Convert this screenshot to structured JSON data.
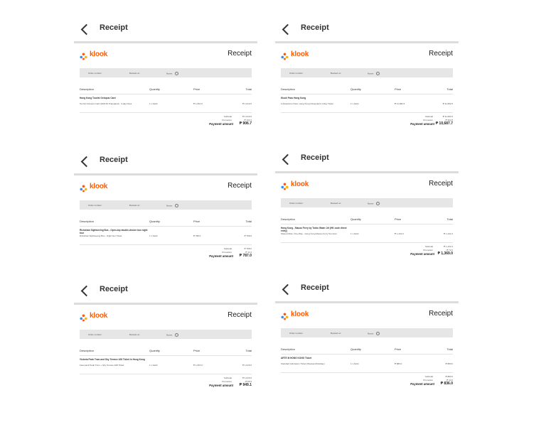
{
  "nav": {
    "title": "Receipt"
  },
  "brand": {
    "name": "klook"
  },
  "labels": {
    "receipt": "Receipt",
    "order_number": "Order number:",
    "booked_on": "Booked on:",
    "name": "Name:",
    "description": "Description",
    "quantity": "Quantity",
    "price": "Price",
    "total": "Total",
    "subtotal": "Subtotal",
    "promotion": "Promotion",
    "payment_amount": "Payment amount"
  },
  "colors": {
    "brand": "#ff5b00",
    "infobar": "#e6e6e6",
    "divider": "#dcdcdc"
  },
  "receipts": [
    {
      "order_number": "",
      "booked_on": "",
      "name": "",
      "item_title": "Hong Kong Tourist Octopus Card",
      "item_desc": "Tourist Octopus Card (HK$ 50 Preloaded) - 3-day Pass",
      "quantity": "1 x Adult",
      "price": "₱ 1,010.0",
      "total": "₱ 1,010.0",
      "subtotal": "₱ 1,010.0",
      "promotion": "- ₱ 103.3",
      "payment": "₱ 906.7"
    },
    {
      "order_number": "",
      "booked_on": "",
      "name": "",
      "item_title": "Klook Pass Hong Kong",
      "item_desc": "2 Attractions Pass: Hong Kong Disneyland 1-Day Ticket",
      "quantity": "1 x Adult",
      "price": "₱ 11,082.5",
      "total": "₱ 11,082.5",
      "subtotal": "₱ 11,082.5",
      "promotion": "- ₱ 394.8",
      "payment": "₱ 10,687.7"
    },
    {
      "order_number": "",
      "booked_on": "",
      "name": "",
      "item_title": "Rickshaw Sightseeing Bus - Open-top double-decker bus night tour",
      "item_desc": "Rickshaw Sightseeing Bus - Night bus Ticket",
      "quantity": "1 x Adult",
      "price": "₱ 798.0",
      "total": "₱ 798.0",
      "subtotal": "₱ 798.0",
      "promotion": "- ₱ 11.0",
      "payment": "₱ 787.0"
    },
    {
      "order_number": "",
      "booked_on": "",
      "name": "",
      "item_title": "Hong Kong - Macau Ferry by Turbo Water Jet (HK code direct entry)",
      "item_desc": "Shared Ride: One-Way - Hong Kong Macau Ferry Terminal",
      "quantity": "1 x Adult",
      "price": "₱ 1,441.0",
      "total": "₱ 1,441.0",
      "subtotal": "₱ 1,441.0",
      "promotion": "- ₱ 72.0",
      "payment": "₱ 1,369.0"
    },
    {
      "order_number": "",
      "booked_on": "",
      "name": "",
      "item_title": "Victoria Peak Tram and Sky Terrace 428 Ticket in Hong Kong",
      "item_desc": "Fast-track Peak Tram + Sky Terrace 428 Ticket",
      "quantity": "1 x Adult",
      "price": "₱ 1,015.0",
      "total": "₱ 1,015.0",
      "subtotal": "₱ 1,015.0",
      "promotion": "- ₱ 65.9",
      "payment": "₱ 949.1"
    },
    {
      "order_number": "",
      "booked_on": "",
      "name": "",
      "item_title": "ARTE M HONG KONG Ticket",
      "item_desc": "Standard Admission Ticket (Weekend/Holiday)",
      "quantity": "1 x Adult",
      "price": "₱ 880.0",
      "total": "₱ 880.0",
      "subtotal": "₱ 880.0",
      "promotion": "- ₱ 44.0",
      "payment": "₱ 836.0"
    }
  ]
}
